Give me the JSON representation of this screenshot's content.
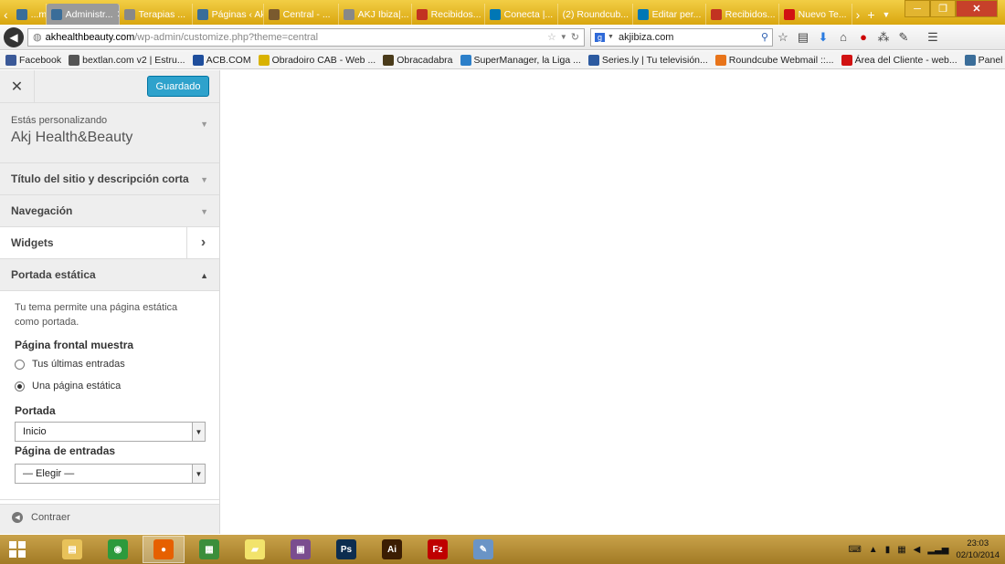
{
  "browser": {
    "tabs": [
      {
        "label": "...me ...",
        "fav_icon": "wordpress-icon",
        "fav_color": "#3a6d99",
        "active": false
      },
      {
        "label": "Administr...",
        "fav_icon": "wordpress-icon",
        "fav_color": "#3a6d99",
        "active": true
      },
      {
        "label": "Terapias ...",
        "fav_icon": "page-icon",
        "fav_color": "#888888",
        "active": false
      },
      {
        "label": "Páginas ‹ Akj ...",
        "fav_icon": "wordpress-icon",
        "fav_color": "#3a6d99",
        "active": false
      },
      {
        "label": "Central - ...",
        "fav_icon": "bookmark-icon",
        "fav_color": "#7a5a2e",
        "active": false
      },
      {
        "label": "AKJ Ibiza|...",
        "fav_icon": "page-icon",
        "fav_color": "#888888",
        "active": false
      },
      {
        "label": "Recibidos...",
        "fav_icon": "gmail-icon",
        "fav_color": "#c23321",
        "active": false
      },
      {
        "label": "Conecta |...",
        "fav_icon": "linkedin-icon",
        "fav_color": "#0077b5",
        "active": false
      },
      {
        "label": "(2) Roundcub...",
        "fav_icon": "",
        "fav_color": "",
        "active": false
      },
      {
        "label": "Editar per...",
        "fav_icon": "linkedin-icon",
        "fav_color": "#0077b5",
        "active": false
      },
      {
        "label": "Recibidos...",
        "fav_icon": "gmail-icon",
        "fav_color": "#c23321",
        "active": false
      },
      {
        "label": "Nuevo Te...",
        "fav_icon": "w-icon",
        "fav_color": "#d11212",
        "active": false
      }
    ],
    "new_tab": "+",
    "url_host": "akhealthbeauty.com",
    "url_path": "/wp-admin/customize.php?theme=central",
    "search_value": "akjibiza.com",
    "bookmarks": [
      {
        "label": "Facebook",
        "icon": "facebook-icon",
        "color": "#3b5998"
      },
      {
        "label": "bextlan.com v2 | Estru...",
        "icon": "bookmark-icon",
        "color": "#555555"
      },
      {
        "label": "ACB.COM",
        "icon": "acb-icon",
        "color": "#1f4e9c"
      },
      {
        "label": "Obradoiro CAB - Web ...",
        "icon": "obradoiro-icon",
        "color": "#d9b200"
      },
      {
        "label": "Obracadabra",
        "icon": "obracadabra-icon",
        "color": "#4a3b1a"
      },
      {
        "label": "SuperManager, la Liga ...",
        "icon": "supermanager-icon",
        "color": "#2c7fc9"
      },
      {
        "label": "Series.ly | Tu televisión...",
        "icon": "seriesly-icon",
        "color": "#2c5aa0"
      },
      {
        "label": "Roundcube Webmail ::...",
        "icon": "cpanel-icon",
        "color": "#e8741a"
      },
      {
        "label": "Área del Cliente - web...",
        "icon": "w-icon",
        "color": "#d11212"
      },
      {
        "label": "Panel de Usuario | BlaB...",
        "icon": "blab-icon",
        "color": "#3a6d99"
      }
    ]
  },
  "customizer": {
    "saved_label": "Guardado",
    "info_small": "Estás personalizando",
    "site_name": "Akj Health&Beauty",
    "sections": [
      {
        "label": "Título del sitio y descripción corta"
      },
      {
        "label": "Navegación"
      },
      {
        "label": "Widgets"
      },
      {
        "label": "Portada estática"
      }
    ],
    "static_front": {
      "description": "Tu tema permite una página estática como portada.",
      "shows_label": "Página frontal muestra",
      "option_latest": "Tus últimas entradas",
      "option_static": "Una página estática",
      "selected_option": "Una página estática",
      "front_label": "Portada",
      "front_value": "Inicio",
      "posts_label": "Página de entradas",
      "posts_value": "— Elegir —"
    },
    "collapse_label": "Contraer"
  },
  "taskbar": {
    "apps": [
      {
        "name": "file-explorer",
        "glyph": "▤",
        "color": "#e8c25a"
      },
      {
        "name": "chrome",
        "glyph": "◉",
        "color": "#2c9a3c"
      },
      {
        "name": "firefox",
        "glyph": "●",
        "color": "#e66000"
      },
      {
        "name": "sheet",
        "glyph": "▦",
        "color": "#3b8e3b"
      },
      {
        "name": "sticky-notes",
        "glyph": "▰",
        "color": "#f2e36b"
      },
      {
        "name": "winrar",
        "glyph": "▣",
        "color": "#7a4d8f"
      },
      {
        "name": "photoshop",
        "glyph": "Ps",
        "color": "#0d2d4f"
      },
      {
        "name": "illustrator",
        "glyph": "Ai",
        "color": "#3b1d03"
      },
      {
        "name": "filezilla",
        "glyph": "Fz",
        "color": "#bf0000"
      },
      {
        "name": "paint",
        "glyph": "✎",
        "color": "#6a94c6"
      }
    ],
    "time": "23:03",
    "date": "02/10/2014"
  }
}
